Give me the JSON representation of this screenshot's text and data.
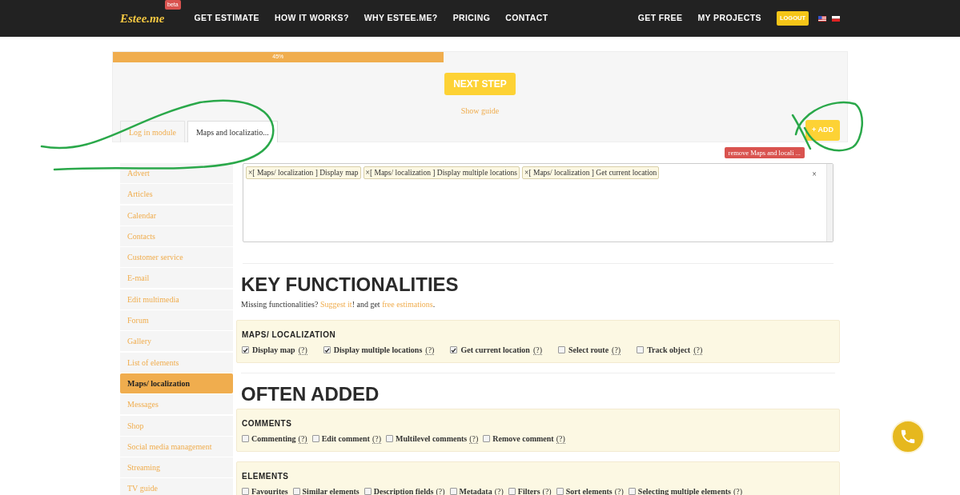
{
  "nav": {
    "logo": "Estee.me",
    "badge": "beta",
    "links": [
      "GET ESTIMATE",
      "HOW IT WORKS?",
      "WHY ESTEE.ME?",
      "PRICING",
      "CONTACT"
    ],
    "right_links": [
      "GET FREE",
      "MY PROJECTS"
    ],
    "logout": "LOGOUT"
  },
  "progress": {
    "level": 0.45,
    "label": "45%"
  },
  "next_step": "NEXT STEP",
  "show_guide": "Show guide",
  "tabs": [
    {
      "label": "Log in module",
      "selected": false
    },
    {
      "label": "Maps and localizatio...",
      "selected": true
    }
  ],
  "add_button": "+ ADD",
  "remove_button": "remove Maps and locali ...",
  "sidebar": {
    "items": [
      {
        "label": "Advert",
        "selected": false
      },
      {
        "label": "Articles",
        "selected": false
      },
      {
        "label": "Calendar",
        "selected": false
      },
      {
        "label": "Contacts",
        "selected": false
      },
      {
        "label": "Customer service",
        "selected": false
      },
      {
        "label": "E-mail",
        "selected": false
      },
      {
        "label": "Edit multimedia",
        "selected": false
      },
      {
        "label": "Forum",
        "selected": false
      },
      {
        "label": "Gallery",
        "selected": false
      },
      {
        "label": "List of elements",
        "selected": false
      },
      {
        "label": "Maps/ localization",
        "selected": true
      },
      {
        "label": "Messages",
        "selected": false
      },
      {
        "label": "Shop",
        "selected": false
      },
      {
        "label": "Social media management",
        "selected": false
      },
      {
        "label": "Streaming",
        "selected": false
      },
      {
        "label": "TV guide",
        "selected": false
      }
    ]
  },
  "tags_field": {
    "tags": [
      {
        "remove": "×",
        "label": "[ Maps/ localization ] Display map"
      },
      {
        "remove": "×",
        "label": "[ Maps/ localization ] Display multiple locations"
      },
      {
        "remove": "×",
        "label": "[ Maps/ localization ] Get current location"
      }
    ],
    "clear": "×"
  },
  "sections": [
    {
      "heading": "KEY FUNCTIONALITIES",
      "intro": [
        {
          "kind": "text",
          "text": "Missing functionalities? "
        },
        {
          "kind": "link",
          "text": "Suggest it"
        },
        {
          "kind": "text",
          "text": "! and get "
        },
        {
          "kind": "link",
          "text": "free estimations"
        },
        {
          "kind": "text",
          "text": "."
        }
      ],
      "groups": [
        {
          "title": "MAPS/ LOCALIZATION",
          "options": [
            {
              "label": "Display map",
              "checked": true,
              "help": "(?)"
            },
            {
              "label": "Display multiple locations",
              "checked": true,
              "help": "(?)"
            },
            {
              "label": "Get current location",
              "checked": true,
              "help": "(?)"
            },
            {
              "label": "Select route",
              "checked": false,
              "help": "(?)"
            },
            {
              "label": "Track object",
              "checked": false,
              "help": "(?)"
            }
          ]
        }
      ]
    },
    {
      "heading": "OFTEN ADDED",
      "groups": [
        {
          "title": "COMMENTS",
          "options": [
            {
              "label": "Commenting",
              "checked": false,
              "help": "(?)"
            },
            {
              "label": "Edit comment",
              "checked": false,
              "help": "(?)"
            },
            {
              "label": "Multilevel comments",
              "checked": false,
              "help": "(?)"
            },
            {
              "label": "Remove comment",
              "checked": false,
              "help": "(?)"
            }
          ]
        },
        {
          "title": "ELEMENTS",
          "options": [
            {
              "label": "Favourites",
              "checked": false
            },
            {
              "label": "Similar elements",
              "checked": false
            },
            {
              "label": "Description fields",
              "checked": false,
              "help": "(?)"
            },
            {
              "label": "Metadata",
              "checked": false,
              "help": "(?)"
            },
            {
              "label": "Filters",
              "checked": false,
              "help": "(?)"
            },
            {
              "label": "Sort elements",
              "checked": false,
              "help": "(?)"
            },
            {
              "label": "Selecting multiple elements",
              "checked": false,
              "help": "(?)"
            }
          ]
        }
      ]
    }
  ]
}
